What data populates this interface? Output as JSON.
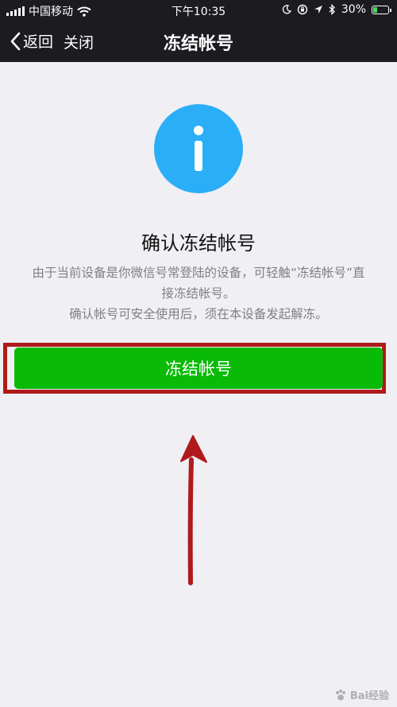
{
  "status_bar": {
    "carrier": "中国移动",
    "time": "下午10:35",
    "battery_percent": "30%",
    "battery_level": 0.3
  },
  "nav": {
    "back_label": "返回",
    "close_label": "关闭",
    "title": "冻结帐号"
  },
  "content": {
    "heading": "确认冻结帐号",
    "description_line1": "由于当前设备是你微信号常登陆的设备，可轻触“冻结帐号”直接冻结帐号。",
    "description_line2": "确认帐号可安全使用后，须在本设备发起解冻。",
    "button_label": "冻结帐号"
  },
  "watermark": "Bai经验",
  "colors": {
    "nav_bg": "#1c1b20",
    "page_bg": "#efeff4",
    "info_icon": "#2aaef8",
    "button_green": "#09bb07",
    "annotation_red": "#b01a1a"
  },
  "icons": [
    "wifi-icon",
    "moon-icon",
    "lock-rotation-icon",
    "location-icon",
    "bluetooth-icon",
    "battery-icon",
    "back-chevron-icon",
    "info-icon"
  ]
}
